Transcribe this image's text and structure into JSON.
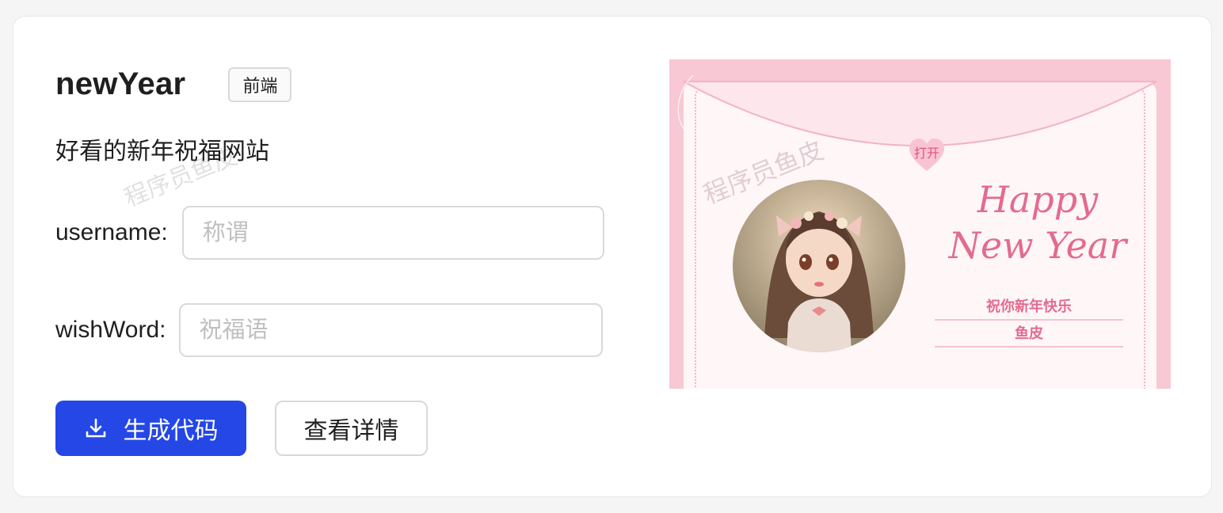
{
  "card": {
    "title": "newYear",
    "tag": "前端",
    "description": "好看的新年祝福网站",
    "watermark": "程序员鱼皮"
  },
  "form": {
    "username": {
      "label": "username",
      "colon": ":",
      "placeholder": "称谓",
      "value": ""
    },
    "wishWord": {
      "label": "wishWord",
      "colon": ":",
      "placeholder": "祝福语",
      "value": ""
    }
  },
  "actions": {
    "generate_label": "生成代码",
    "generate_icon": "download-icon",
    "details_label": "查看详情"
  },
  "preview": {
    "open_button": "打开",
    "happy_line1": "Happy",
    "happy_line2": "New Year",
    "greeting": "祝你新年快乐",
    "sender": "鱼皮",
    "watermark": "程序员鱼皮"
  },
  "colors": {
    "primary": "#2447e6",
    "preview_pink": "#f8c8d4",
    "preview_text": "#e36b8d"
  }
}
